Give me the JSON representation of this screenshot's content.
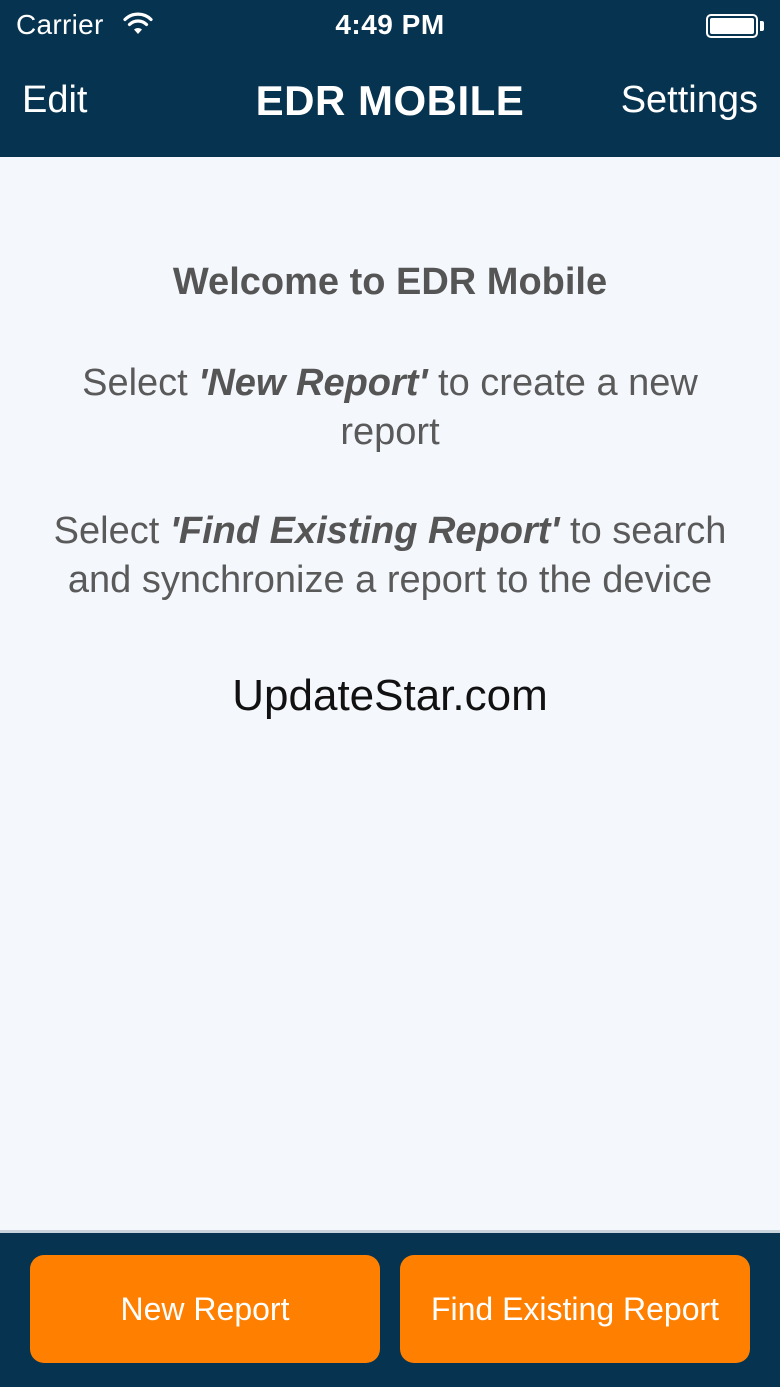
{
  "status_bar": {
    "carrier": "Carrier",
    "time": "4:49 PM",
    "wifi_icon": "wifi-icon",
    "battery_icon": "battery-icon"
  },
  "nav": {
    "edit_label": "Edit",
    "title": "EDR MOBILE",
    "settings_label": "Settings"
  },
  "welcome": {
    "heading": "Welcome to EDR Mobile",
    "para1_prefix": "Select ",
    "para1_quoted": "'New Report'",
    "para1_suffix": " to create a new report",
    "para2_prefix": "Select ",
    "para2_quoted": "'Find Existing Report'",
    "para2_suffix": " to search and synchronize a report to the device"
  },
  "watermark": "UpdateStar.com",
  "buttons": {
    "new_report": "New Report",
    "find_existing_report": "Find Existing Report"
  },
  "colors": {
    "bar_background": "#06334f",
    "button_accent": "#ff7f00",
    "content_background": "#f4f8fd"
  }
}
